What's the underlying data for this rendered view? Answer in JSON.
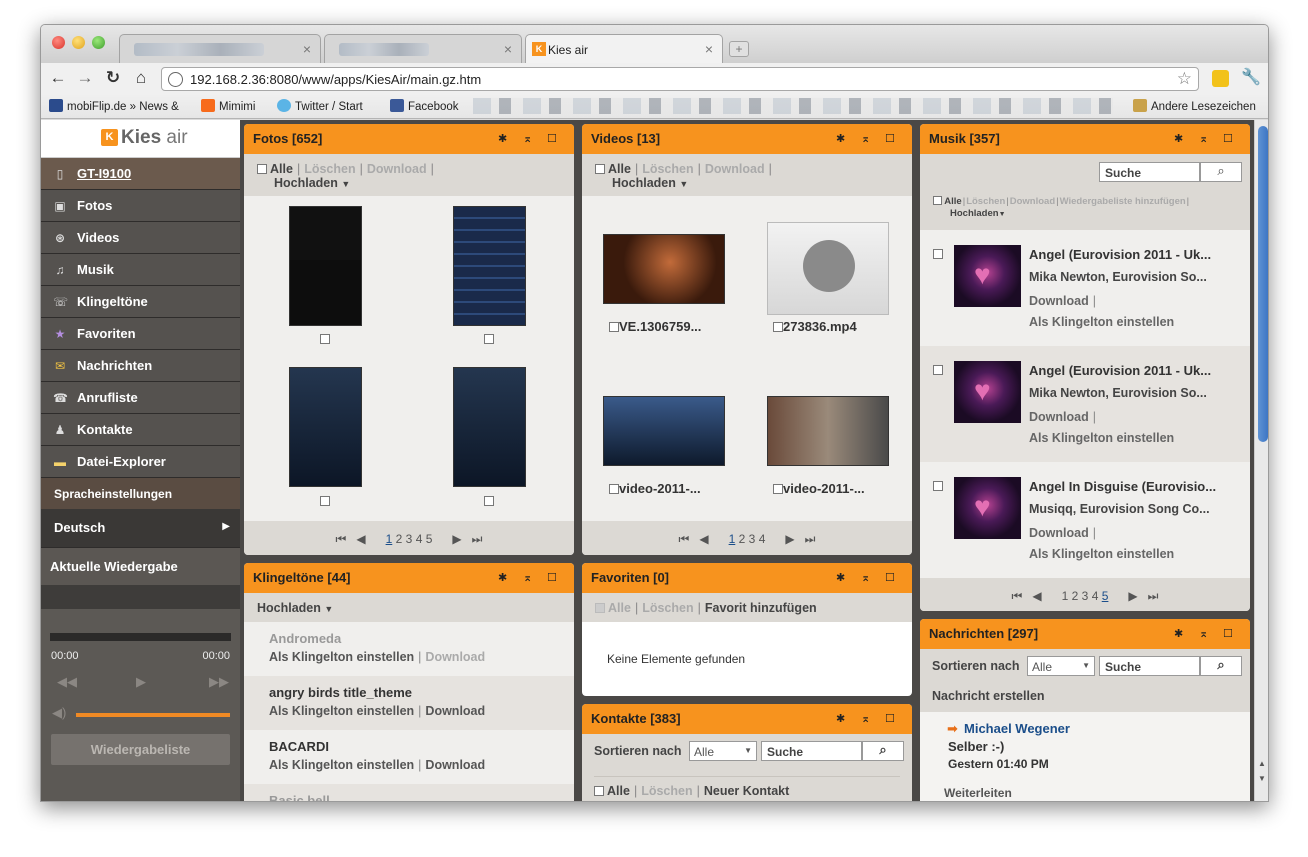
{
  "browser": {
    "tabs": [
      {
        "label": ""
      },
      {
        "label": ""
      },
      {
        "label": "Kies air",
        "close": "×"
      }
    ],
    "url": "192.168.2.36:8080/www/apps/KiesAir/main.gz.htm",
    "bookmarks": [
      "mobiFlip.de » News &",
      "Mimimi",
      "Twitter / Start",
      "Facebook"
    ],
    "other_bookmarks": "Andere Lesezeichen",
    "colors": {
      "accent": "#f7931e",
      "sidebar": "#3e3c3a"
    }
  },
  "logo": {
    "brand": "Kies",
    "suffix": "air"
  },
  "sidebar": {
    "device": "GT-I9100",
    "items": [
      "Fotos",
      "Videos",
      "Musik",
      "Klingeltöne",
      "Favoriten",
      "Nachrichten",
      "Anrufliste",
      "Kontakte",
      "Datei-Explorer"
    ],
    "language_header": "Spracheinstellungen",
    "language": "Deutsch",
    "player_header": "Aktuelle Wiedergabe",
    "time_start": "00:00",
    "time_end": "00:00",
    "playlist": "Wiedergabeliste"
  },
  "actions": {
    "all": "Alle",
    "delete": "Löschen",
    "download": "Download",
    "upload": "Hochladen",
    "separator": "|",
    "set_ringtone": "Als Klingelton einstellen",
    "add_playlist": "Wiedergabeliste hinzufügen",
    "add_favorite": "Favorit hinzufügen",
    "new_contact": "Neuer Kontakt",
    "sort_by": "Sortieren nach",
    "sort_value": "Alle",
    "search": "Suche",
    "compose": "Nachricht erstellen",
    "forward": "Weiterleiten"
  },
  "fotos": {
    "title": "Fotos [652]",
    "pages": [
      "1",
      "2",
      "3",
      "4",
      "5"
    ]
  },
  "videos": {
    "title": "Videos [13]",
    "items": [
      "VE.1306759...",
      "273836.mp4",
      "video-2011-...",
      "video-2011-..."
    ],
    "pages": [
      "1",
      "2",
      "3",
      "4"
    ]
  },
  "musik": {
    "title": "Musik [357]",
    "tracks": [
      {
        "title": "Angel (Eurovision 2011 - Uk...",
        "artist": "Mika Newton, Eurovision So..."
      },
      {
        "title": "Angel (Eurovision 2011 - Uk...",
        "artist": "Mika Newton, Eurovision So..."
      },
      {
        "title": "Angel In Disguise (Eurovisio...",
        "artist": "Musiqq, Eurovision Song Co..."
      }
    ],
    "pages": [
      "1",
      "2",
      "3",
      "4",
      "5"
    ]
  },
  "klingeltoene": {
    "title": "Klingeltöne [44]",
    "items": [
      "Andromeda",
      "angry birds title_theme",
      "BACARDI",
      "Basic bell"
    ]
  },
  "favoriten": {
    "title": "Favoriten [0]",
    "empty": "Keine Elemente gefunden"
  },
  "kontakte": {
    "title": "Kontakte [383]"
  },
  "nachrichten": {
    "title": "Nachrichten [297]",
    "sender": "Michael Wegener",
    "body": "Selber :-)",
    "time": "Gestern 01:40 PM"
  }
}
